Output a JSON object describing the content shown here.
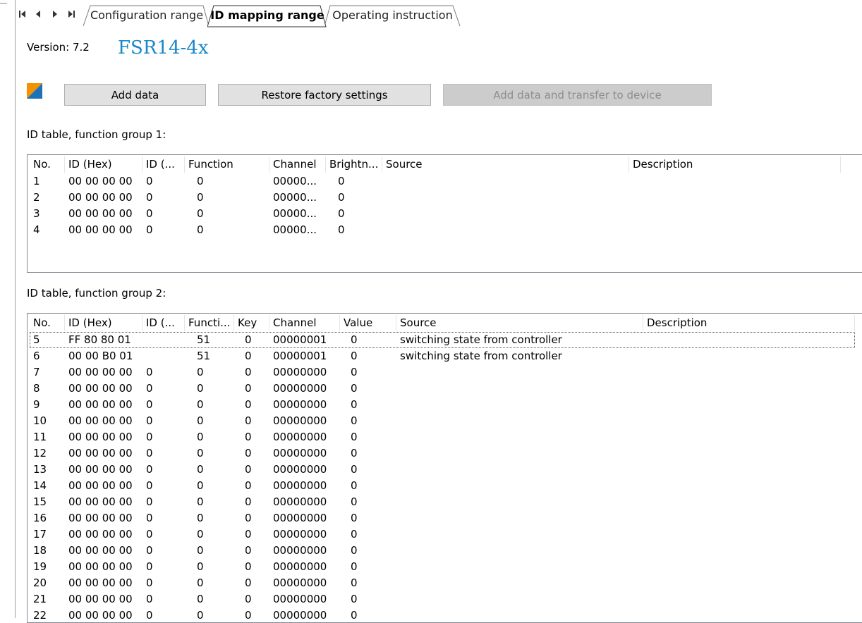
{
  "tabs": [
    {
      "label": "Configuration range",
      "active": false
    },
    {
      "label": "ID mapping range",
      "active": true
    },
    {
      "label": "Operating instruction",
      "active": false
    }
  ],
  "header": {
    "version_label": "Version: 7.2",
    "device_title": "FSR14-4x"
  },
  "toolbar": {
    "add_data": "Add data",
    "restore": "Restore factory settings",
    "add_transfer": "Add data and transfer to device"
  },
  "group1": {
    "label": "ID table, function group 1:",
    "columns": [
      "No.",
      "ID (Hex)",
      "ID (...",
      "Function",
      "Channel",
      "Brightn...",
      "Source",
      "Description"
    ],
    "rows": [
      [
        "1",
        "00 00 00 00",
        "0",
        "0",
        "00000...",
        "0",
        "",
        ""
      ],
      [
        "2",
        "00 00 00 00",
        "0",
        "0",
        "00000...",
        "0",
        "",
        ""
      ],
      [
        "3",
        "00 00 00 00",
        "0",
        "0",
        "00000...",
        "0",
        "",
        ""
      ],
      [
        "4",
        "00 00 00 00",
        "0",
        "0",
        "00000...",
        "0",
        "",
        ""
      ]
    ]
  },
  "group2": {
    "label": "ID table, function group 2:",
    "columns": [
      "No.",
      "ID (Hex)",
      "ID (...",
      "Functi...",
      "Key",
      "Channel",
      "Value",
      "Source",
      "Description"
    ],
    "rows": [
      [
        "5",
        "FF 80 80 01",
        "",
        "51",
        "0",
        "00000001",
        "0",
        "switching state from controller",
        ""
      ],
      [
        "6",
        "00 00 B0 01",
        "",
        "51",
        "0",
        "00000001",
        "0",
        "switching state from controller",
        ""
      ],
      [
        "7",
        "00 00 00 00",
        "0",
        "0",
        "0",
        "00000000",
        "0",
        "",
        ""
      ],
      [
        "8",
        "00 00 00 00",
        "0",
        "0",
        "0",
        "00000000",
        "0",
        "",
        ""
      ],
      [
        "9",
        "00 00 00 00",
        "0",
        "0",
        "0",
        "00000000",
        "0",
        "",
        ""
      ],
      [
        "10",
        "00 00 00 00",
        "0",
        "0",
        "0",
        "00000000",
        "0",
        "",
        ""
      ],
      [
        "11",
        "00 00 00 00",
        "0",
        "0",
        "0",
        "00000000",
        "0",
        "",
        ""
      ],
      [
        "12",
        "00 00 00 00",
        "0",
        "0",
        "0",
        "00000000",
        "0",
        "",
        ""
      ],
      [
        "13",
        "00 00 00 00",
        "0",
        "0",
        "0",
        "00000000",
        "0",
        "",
        ""
      ],
      [
        "14",
        "00 00 00 00",
        "0",
        "0",
        "0",
        "00000000",
        "0",
        "",
        ""
      ],
      [
        "15",
        "00 00 00 00",
        "0",
        "0",
        "0",
        "00000000",
        "0",
        "",
        ""
      ],
      [
        "16",
        "00 00 00 00",
        "0",
        "0",
        "0",
        "00000000",
        "0",
        "",
        ""
      ],
      [
        "17",
        "00 00 00 00",
        "0",
        "0",
        "0",
        "00000000",
        "0",
        "",
        ""
      ],
      [
        "18",
        "00 00 00 00",
        "0",
        "0",
        "0",
        "00000000",
        "0",
        "",
        ""
      ],
      [
        "19",
        "00 00 00 00",
        "0",
        "0",
        "0",
        "00000000",
        "0",
        "",
        ""
      ],
      [
        "20",
        "00 00 00 00",
        "0",
        "0",
        "0",
        "00000000",
        "0",
        "",
        ""
      ],
      [
        "21",
        "00 00 00 00",
        "0",
        "0",
        "0",
        "00000000",
        "0",
        "",
        ""
      ],
      [
        "22",
        "00 00 00 00",
        "0",
        "0",
        "0",
        "00000000",
        "0",
        "",
        ""
      ]
    ]
  },
  "colors": {
    "title_blue": "#1888c7",
    "logo_orange": "#f39200",
    "logo_blue": "#1d71b8",
    "disabled_text": "#8d8d8d"
  },
  "icons": [
    "first-page-icon",
    "previous-icon",
    "next-icon",
    "last-page-icon",
    "eltako-logo-icon"
  ]
}
